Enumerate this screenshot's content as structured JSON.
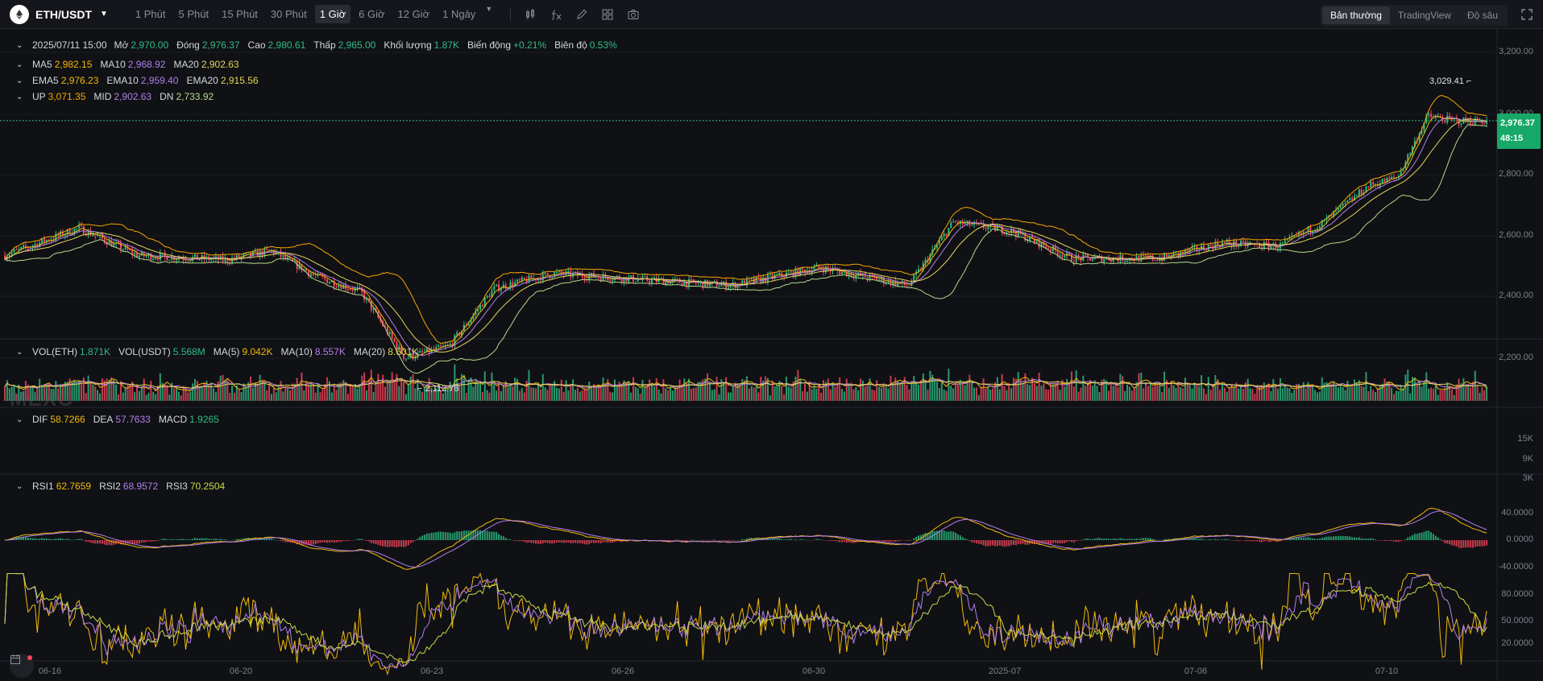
{
  "toolbar": {
    "symbol": "ETH/USDT",
    "symbol_icon": "ethereum-icon",
    "intervals": [
      "1 Phút",
      "5 Phút",
      "15 Phút",
      "30 Phút",
      "1 Giờ",
      "6 Giờ",
      "12 Giờ",
      "1 Ngày"
    ],
    "active_interval": "1 Giờ",
    "tools": [
      "candle-type-icon",
      "indicator-fx-icon",
      "draw-pencil-icon",
      "layout-grid-icon",
      "camera-icon"
    ],
    "views": [
      "Bản thường",
      "TradingView",
      "Độ sâu"
    ],
    "active_view": "Bản thường"
  },
  "ohlc": {
    "date": "2025/07/11 15:00",
    "open_label": "Mở",
    "open": "2,970.00",
    "close_label": "Đóng",
    "close": "2,976.37",
    "high_label": "Cao",
    "high": "2,980.61",
    "low_label": "Thấp",
    "low": "2,965.00",
    "volume_label": "Khối lượng",
    "volume": "1.87K",
    "change_label": "Biến động",
    "change": "+0.21%",
    "amplitude_label": "Biên độ",
    "amplitude": "0.53%"
  },
  "ma": {
    "ma5_label": "MA5",
    "ma5": "2,982.15",
    "ma10_label": "MA10",
    "ma10": "2,968.92",
    "ma20_label": "MA20",
    "ma20": "2,902.63"
  },
  "ema": {
    "ema5_label": "EMA5",
    "ema5": "2,976.23",
    "ema10_label": "EMA10",
    "ema10": "2,959.40",
    "ema20_label": "EMA20",
    "ema20": "2,915.56"
  },
  "boll": {
    "up_label": "UP",
    "up": "3,071.35",
    "mid_label": "MID",
    "mid": "2,902.63",
    "dn_label": "DN",
    "dn": "2,733.92"
  },
  "vol": {
    "eth_label": "VOL(ETH)",
    "eth": "1.871K",
    "usdt_label": "VOL(USDT)",
    "usdt": "5.568M",
    "ma5_label": "MA(5)",
    "ma5": "9.042K",
    "ma10_label": "MA(10)",
    "ma10": "8.557K",
    "ma20_label": "MA(20)",
    "ma20": "8.601K"
  },
  "macd": {
    "dif_label": "DIF",
    "dif": "58.7266",
    "dea_label": "DEA",
    "dea": "57.7633",
    "macd_label": "MACD",
    "macd": "1.9265"
  },
  "rsi": {
    "rsi1_label": "RSI1",
    "rsi1": "62.7659",
    "rsi2_label": "RSI2",
    "rsi2": "68.9572",
    "rsi3_label": "RSI3",
    "rsi3": "70.2504"
  },
  "price_axis": [
    "3,200.00",
    "3,000.00",
    "2,800.00",
    "2,600.00",
    "2,400.00",
    "2,200.00"
  ],
  "vol_axis": [
    "15K",
    "9K",
    "3K"
  ],
  "macd_axis": [
    "40.0000",
    "0.0000",
    "-40.0000"
  ],
  "rsi_axis": [
    "80.0000",
    "50.0000",
    "20.0000"
  ],
  "dates": [
    "06-16",
    "06-20",
    "06-23",
    "06-26",
    "06-30",
    "2025-07",
    "07-06",
    "07-10"
  ],
  "last_price": "2,976.37",
  "countdown": "48:15",
  "high_mark": "3,029.41",
  "low_mark": "2,112.78",
  "watermark": "MEXC",
  "colors": {
    "up": "#2ebd85",
    "down": "#f6465d",
    "background": "#101115"
  }
}
